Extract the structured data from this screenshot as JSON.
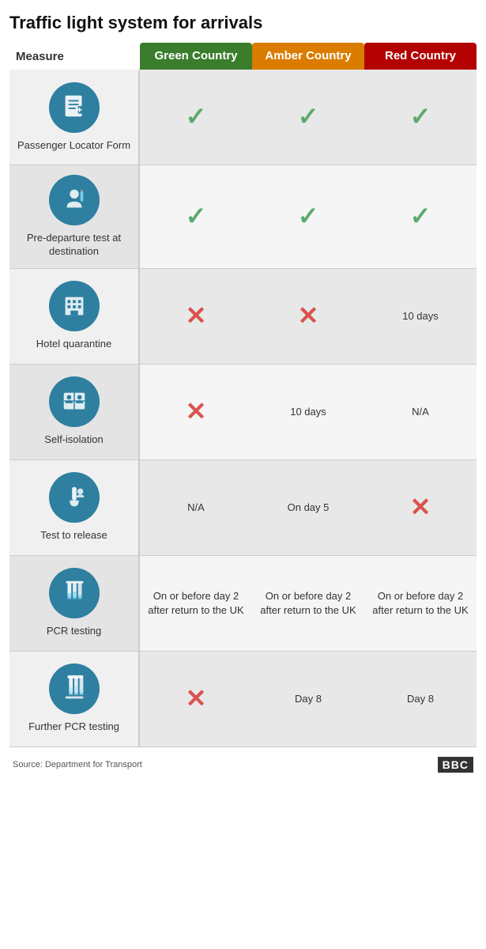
{
  "title": "Traffic light system for arrivals",
  "header": {
    "measure_label": "Measure",
    "green_label": "Green Country",
    "amber_label": "Amber Country",
    "red_label": "Red Country"
  },
  "rows": [
    {
      "id": "passenger-locator",
      "measure_label": "Passenger Locator Form",
      "icon_name": "document-icon",
      "icon_symbol": "📋",
      "green": {
        "type": "check"
      },
      "amber": {
        "type": "check"
      },
      "red": {
        "type": "check"
      }
    },
    {
      "id": "pre-departure",
      "measure_label": "Pre-departure test at destination",
      "icon_name": "test-tube-icon",
      "icon_symbol": "🧪",
      "green": {
        "type": "check"
      },
      "amber": {
        "type": "check"
      },
      "red": {
        "type": "check"
      }
    },
    {
      "id": "hotel-quarantine",
      "measure_label": "Hotel quarantine",
      "icon_name": "hotel-icon",
      "icon_symbol": "🏨",
      "green": {
        "type": "cross"
      },
      "amber": {
        "type": "cross"
      },
      "red": {
        "type": "text",
        "value": "10 days"
      }
    },
    {
      "id": "self-isolation",
      "measure_label": "Self-isolation",
      "icon_name": "isolation-icon",
      "icon_symbol": "🪟",
      "green": {
        "type": "cross"
      },
      "amber": {
        "type": "text",
        "value": "10 days"
      },
      "red": {
        "type": "text",
        "value": "N/A"
      }
    },
    {
      "id": "test-to-release",
      "measure_label": "Test to release",
      "icon_name": "test-release-icon",
      "icon_symbol": "🧫",
      "green": {
        "type": "text",
        "value": "N/A"
      },
      "amber": {
        "type": "text",
        "value": "On day 5"
      },
      "red": {
        "type": "cross"
      }
    },
    {
      "id": "pcr-testing",
      "measure_label": "PCR testing",
      "icon_name": "pcr-icon",
      "icon_symbol": "🧬",
      "green": {
        "type": "text",
        "value": "On or before day 2 after return to the UK"
      },
      "amber": {
        "type": "text",
        "value": "On or before day 2 after return to the UK"
      },
      "red": {
        "type": "text",
        "value": "On or before day 2 after return to the UK"
      }
    },
    {
      "id": "further-pcr",
      "measure_label": "Further PCR testing",
      "icon_name": "further-pcr-icon",
      "icon_symbol": "🔬",
      "green": {
        "type": "cross"
      },
      "amber": {
        "type": "text",
        "value": "Day 8"
      },
      "red": {
        "type": "text",
        "value": "Day 8"
      }
    }
  ],
  "source": "Source: Department for Transport",
  "bbc": "BBC"
}
